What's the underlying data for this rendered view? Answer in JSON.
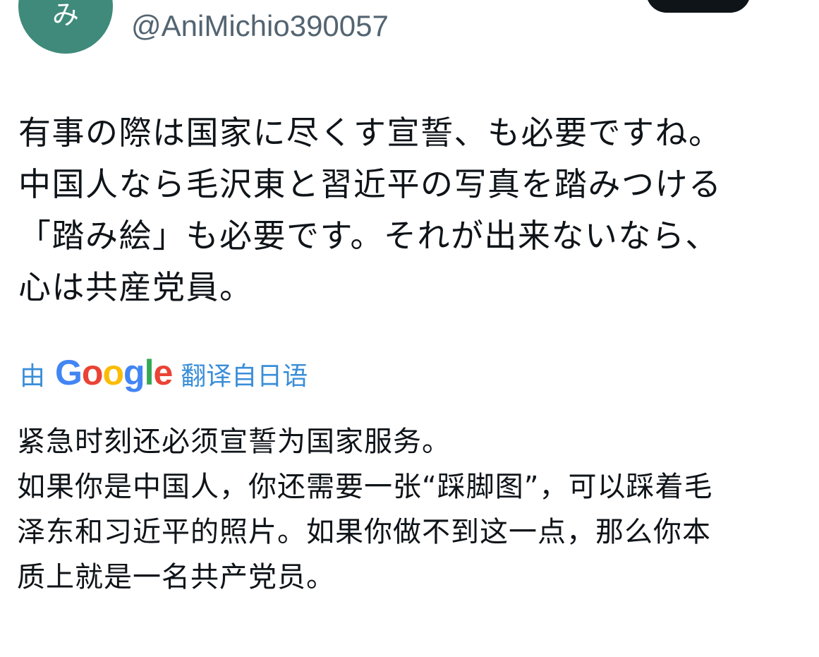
{
  "author": {
    "avatar_glyph": "み",
    "avatar_color": "#3f8a7b",
    "handle": "@AniMichio390057"
  },
  "tweet": {
    "lines": [
      "有事の際は国家に尽くす宣誓、も必要ですね。",
      "中国人なら毛沢東と習近平の写真を踏みつける",
      "「踏み絵」も必要です。それが出来ないなら、",
      "心は共産党員。"
    ]
  },
  "translation_bar": {
    "by_label": "由",
    "provider": "Google",
    "translated_from_label": "翻译自日语",
    "link_color": "#1d9bf0"
  },
  "translation": {
    "lines": [
      "紧急时刻还必须宣誓为国家服务。",
      "如果你是中国人，你还需要一张“踩脚图”，可以踩着毛",
      "泽东和习近平的照片。如果你做不到这一点，那么你本",
      "质上就是一名共产党员。"
    ]
  },
  "colors": {
    "text_primary": "#0f1419",
    "text_secondary": "#536471",
    "button_bg": "#0f1419"
  }
}
